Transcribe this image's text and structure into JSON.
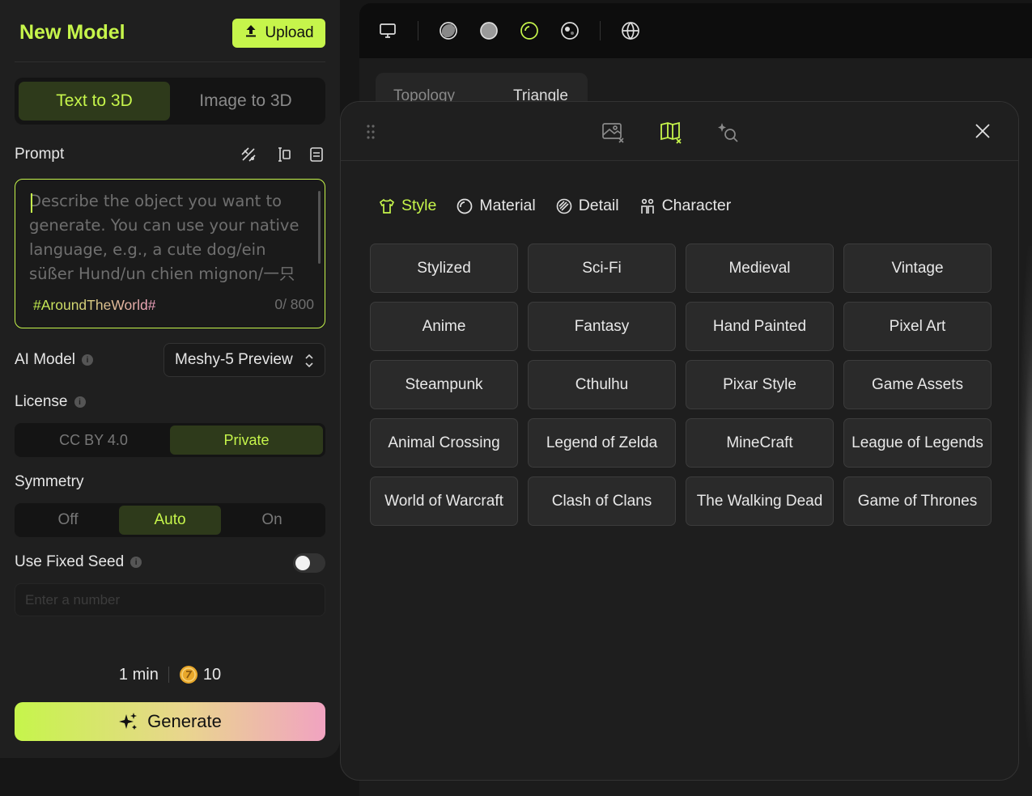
{
  "panel": {
    "title": "New Model",
    "upload_label": "Upload",
    "modes": [
      "Text to 3D",
      "Image to 3D"
    ],
    "prompt_label": "Prompt",
    "prompt_placeholder": "Describe the object you want to generate. You can use your native language, e.g., a cute dog/ein süßer Hund/un chien mignon/一只",
    "prompt_value": "",
    "prompt_tag": "#AroundTheWorld#",
    "prompt_counter": "0/ 800",
    "ai_model_label": "AI Model",
    "ai_model_value": "Meshy-5 Preview",
    "license_label": "License",
    "license_options": [
      "CC BY 4.0",
      "Private"
    ],
    "symmetry_label": "Symmetry",
    "symmetry_options": [
      "Off",
      "Auto",
      "On"
    ],
    "seed_label": "Use Fixed Seed",
    "seed_placeholder": "Enter a number",
    "time_label": "1 min",
    "credits": "10",
    "generate_label": "Generate"
  },
  "viewer": {
    "topology_tabs": [
      "Topology",
      "Triangle"
    ]
  },
  "popup": {
    "categories": [
      "Style",
      "Material",
      "Detail",
      "Character"
    ],
    "styles": [
      "Stylized",
      "Sci-Fi",
      "Medieval",
      "Vintage",
      "Anime",
      "Fantasy",
      "Hand Painted",
      "Pixel Art",
      "Steampunk",
      "Cthulhu",
      "Pixar Style",
      "Game Assets",
      "Animal Crossing",
      "Legend of Zelda",
      "MineCraft",
      "League of Legends",
      "World of Warcraft",
      "Clash of Clans",
      "The Walking Dead",
      "Game of Thrones"
    ]
  },
  "colors": {
    "accent": "#c6f54b",
    "panel_bg": "#1f1f1f",
    "button_bg": "#2a2a2a",
    "gradient_end": "#f1a3c1"
  }
}
